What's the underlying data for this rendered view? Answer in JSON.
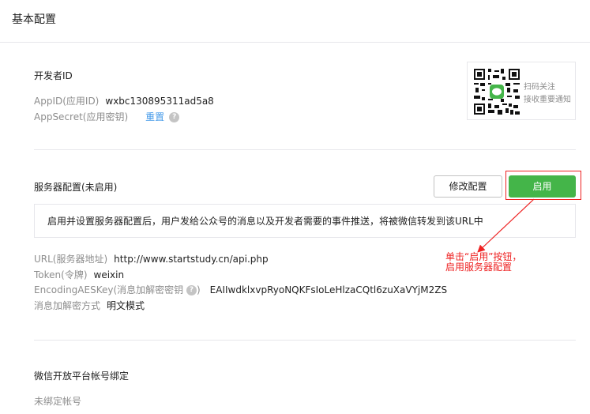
{
  "header": {
    "title": "基本配置"
  },
  "developer": {
    "title": "开发者ID",
    "appid_label": "AppID(应用ID)",
    "appid_value": "wxbc130895311ad5a8",
    "appsecret_label": "AppSecret(应用密钥)",
    "reset_link": "重置",
    "help": "?"
  },
  "qr": {
    "line1": "扫码关注",
    "line2": "接收重要通知"
  },
  "server": {
    "title": "服务器配置(未启用)",
    "modify_button": "修改配置",
    "enable_button": "启用",
    "notice": "启用并设置服务器配置后，用户发给公众号的消息以及开发者需要的事件推送，将被微信转发到该URL中",
    "url_label": "URL(服务器地址)",
    "url_value": "http://www.startstudy.cn/api.php",
    "token_label": "Token(令牌)",
    "token_value": "weixin",
    "aes_label": "EncodingAESKey(消息加解密密钥",
    "aes_label_end": ")",
    "aes_value": "EAIIwdklxvpRyoNQKFsIoLeHlzaCQtl6zuXaVYjM2ZS",
    "mode_label": "消息加解密方式",
    "mode_value": "明文模式"
  },
  "annotation": {
    "line1": "单击“启用”按钮，",
    "line2": "启用服务器配置"
  },
  "open_platform": {
    "title": "微信开放平台帐号绑定",
    "unbound": "未绑定帐号"
  },
  "colors": {
    "accent_green": "#44b549",
    "link_blue": "#459ae9",
    "annotation_red": "#e22222"
  }
}
